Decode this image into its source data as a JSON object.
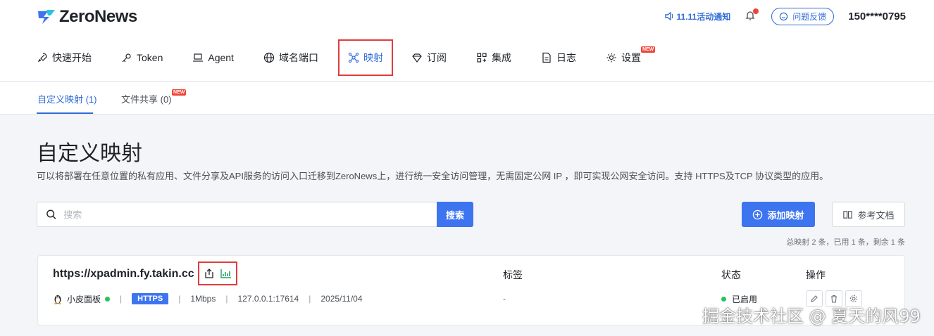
{
  "header": {
    "brand": "ZeroNews",
    "notice": "11.11活动通知",
    "feedback": "问题反馈",
    "phone": "150****0795"
  },
  "nav": {
    "items": [
      {
        "label": "快速开始",
        "icon": "rocket-icon"
      },
      {
        "label": "Token",
        "icon": "key-icon"
      },
      {
        "label": "Agent",
        "icon": "laptop-icon"
      },
      {
        "label": "域名端口",
        "icon": "globe-icon"
      },
      {
        "label": "映射",
        "icon": "network-icon"
      },
      {
        "label": "订阅",
        "icon": "diamond-icon"
      },
      {
        "label": "集成",
        "icon": "grid-icon"
      },
      {
        "label": "日志",
        "icon": "file-icon"
      },
      {
        "label": "设置",
        "icon": "gear-icon"
      }
    ],
    "new_badge": "NEW"
  },
  "subtabs": {
    "custom": "自定义映射 (1)",
    "share": "文件共享 (0)",
    "new_badge": "NEW"
  },
  "page": {
    "title": "自定义映射",
    "description": "可以将部署在任意位置的私有应用、文件分享及API服务的访问入口迁移到ZeroNews上，进行统一安全访问管理，无需固定公网 IP ，即可实现公网安全访问。支持 HTTPS及TCP 协议类型的应用。"
  },
  "search": {
    "placeholder": "搜索",
    "button": "搜索"
  },
  "actions": {
    "add": "添加映射",
    "docs": "参考文档"
  },
  "quota": "总映射 2 条，已用 1 条，剩余 1 条",
  "mapping": {
    "url": "https://xpadmin.fy.takin.cc",
    "col_tags": "标签",
    "col_status": "状态",
    "col_ops": "操作",
    "agent": "小皮面板",
    "protocol": "HTTPS",
    "bandwidth": "1Mbps",
    "target": "127.0.0.1:17614",
    "date": "2025/11/04",
    "tags": "-",
    "status": "已启用"
  },
  "watermark": "掘金技术社区 @ 夏天的风99",
  "colors": {
    "accent": "#3d74f0",
    "link": "#2f6bd6",
    "highlight": "#e03c3c",
    "status_ok": "#22c55e"
  }
}
